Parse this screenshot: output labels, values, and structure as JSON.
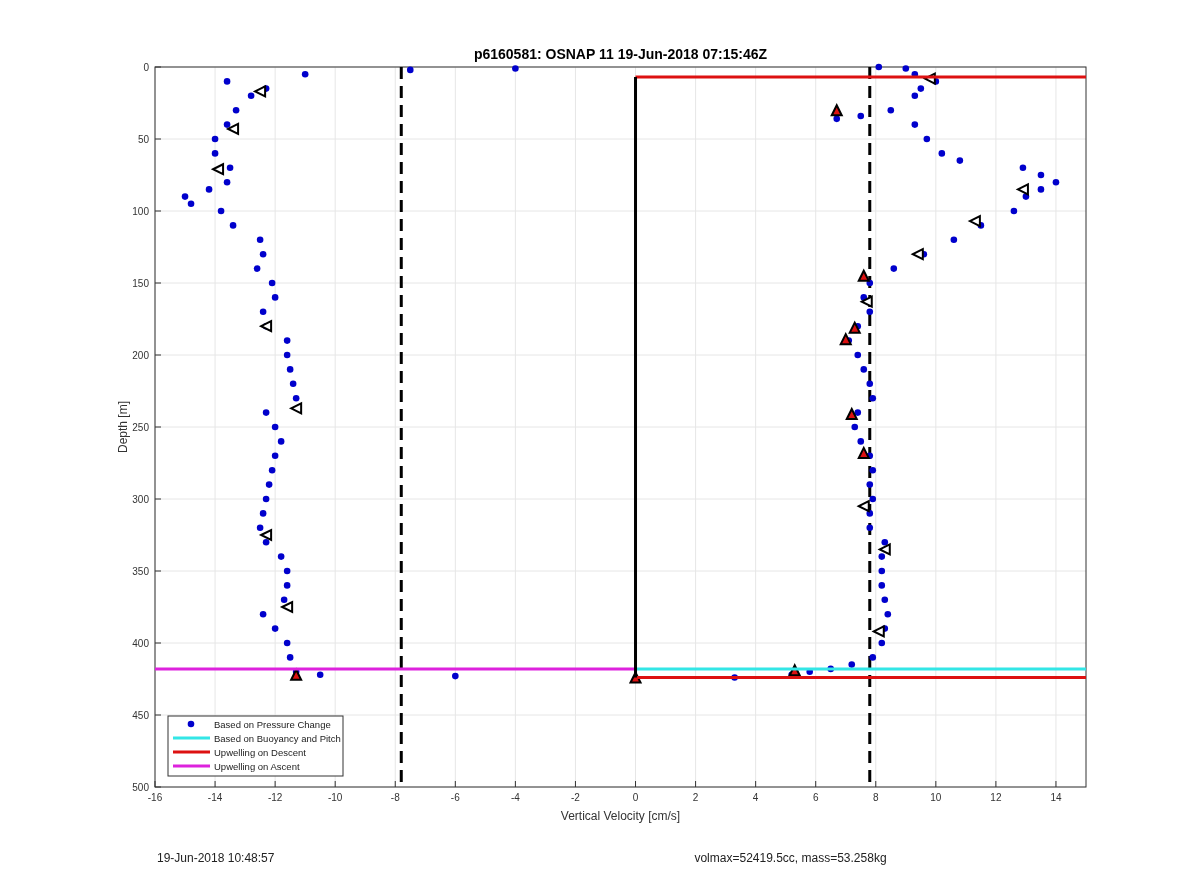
{
  "chart_data": {
    "type": "scatter",
    "title": "p6160581: OSNAP 11 19-Jun-2018 07:15:46Z",
    "xlabel": "Vertical Velocity [cm/s]",
    "ylabel": "Depth [m]",
    "grid": true,
    "legend": true,
    "xlim": [
      -16,
      15
    ],
    "ylim": [
      500,
      0
    ],
    "xticks": [
      -16,
      -14,
      -12,
      -10,
      -8,
      -6,
      -4,
      -2,
      0,
      2,
      4,
      6,
      8,
      10,
      12,
      14
    ],
    "yticks": [
      0,
      50,
      100,
      150,
      200,
      250,
      300,
      350,
      400,
      450,
      500
    ],
    "x": [
      -16,
      0,
      15,
      0,
      -11,
      -13.6,
      -12.3,
      -12.8,
      -13.3,
      -13.6,
      -14,
      -14,
      -13.5,
      -13.6,
      -14.2,
      -15,
      -14.8,
      -13.8,
      -13.4,
      -12.5,
      -12.4,
      -12.6,
      -12.1,
      -12,
      -12.4,
      -12.3,
      -11.6,
      -11.6,
      -11.5,
      -11.4,
      -11.3,
      -12.3,
      -12,
      -11.8,
      -12,
      -12.1,
      -12.2,
      -12.3,
      -12.4,
      -12.5,
      -12.3,
      -11.8,
      -11.6,
      -11.6,
      -11.7,
      -12.4,
      -12,
      -11.6,
      -11.5,
      -11.3,
      -10.5,
      -7.5,
      -4,
      -6,
      8.1,
      9,
      9.3,
      10,
      9.5,
      9.3,
      8.5,
      6.7,
      7.5,
      9.3,
      9.7,
      10.2,
      10.8,
      12.9,
      13.5,
      14,
      13.5,
      13,
      12.6,
      11.5,
      10.6,
      9.6,
      8.6,
      7.8,
      7.6,
      7.8,
      7.4,
      7.1,
      7.4,
      7.6,
      7.8,
      7.9,
      7.4,
      7.3,
      7.5,
      7.8,
      7.9,
      7.8,
      7.9,
      7.8,
      7.8,
      8.3,
      8.2,
      8.2,
      8.2,
      8.3,
      8.4,
      8.3,
      8.2,
      7.9,
      7.2,
      6.5,
      5.8,
      5.2,
      3.3,
      -12.5,
      -13.4,
      -13.9,
      -12.3,
      -11.3,
      -12.3,
      -11.6,
      9.8,
      12.9,
      11.3,
      9.4,
      7.7,
      7.6,
      8.3,
      8.1,
      -11.3,
      6.7,
      7.6,
      7.3,
      7,
      7.2,
      7.6,
      5.3,
      0
    ],
    "series": [
      {
        "name": "Based on Pressure Change",
        "type": "scatter",
        "color": "#0000cc",
        "values": [
          null,
          null,
          null,
          null,
          5,
          10,
          15,
          20,
          30,
          40,
          50,
          60,
          70,
          80,
          85,
          90,
          95,
          100,
          110,
          120,
          130,
          140,
          150,
          160,
          170,
          180,
          190,
          200,
          210,
          220,
          230,
          240,
          250,
          260,
          270,
          280,
          290,
          300,
          310,
          320,
          330,
          340,
          350,
          360,
          370,
          380,
          390,
          400,
          410,
          420,
          422,
          2,
          1,
          423,
          0,
          1,
          5,
          10,
          15,
          20,
          30,
          36,
          34,
          40,
          50,
          60,
          65,
          70,
          75,
          80,
          85,
          90,
          100,
          110,
          120,
          130,
          140,
          150,
          160,
          170,
          180,
          190,
          200,
          210,
          220,
          230,
          240,
          250,
          260,
          270,
          280,
          290,
          300,
          310,
          320,
          330,
          340,
          350,
          360,
          370,
          380,
          390,
          400,
          410,
          415,
          418,
          420,
          422,
          424,
          null,
          null,
          null,
          null,
          null,
          null,
          null,
          null,
          null,
          null,
          null,
          null,
          null,
          null,
          null,
          null,
          null,
          null,
          null,
          null,
          null,
          null,
          null,
          null
        ]
      },
      {
        "type": "scatter",
        "values": [
          null,
          null,
          null,
          null,
          null,
          null,
          null,
          null,
          null,
          null,
          null,
          null,
          null,
          null,
          null,
          null,
          null,
          null,
          null,
          null,
          null,
          null,
          null,
          null,
          null,
          null,
          null,
          null,
          null,
          null,
          null,
          null,
          null,
          null,
          null,
          null,
          null,
          null,
          null,
          null,
          null,
          null,
          null,
          null,
          null,
          null,
          null,
          null,
          null,
          null,
          null,
          null,
          null,
          null,
          null,
          null,
          null,
          null,
          null,
          null,
          null,
          null,
          null,
          null,
          null,
          null,
          null,
          null,
          null,
          null,
          null,
          null,
          null,
          null,
          null,
          null,
          null,
          null,
          null,
          null,
          null,
          null,
          null,
          null,
          null,
          null,
          null,
          null,
          null,
          null,
          null,
          null,
          null,
          null,
          null,
          null,
          null,
          null,
          null,
          null,
          null,
          null,
          null,
          null,
          null,
          null,
          null,
          null,
          null,
          17,
          43,
          71,
          180,
          237,
          325,
          375,
          8,
          85,
          107,
          130,
          163,
          305,
          335,
          392,
          null,
          null,
          null,
          null,
          null,
          null,
          null,
          null,
          null
        ]
      },
      {
        "type": "scatter",
        "color": "#dd1111",
        "values": [
          null,
          null,
          null,
          null,
          null,
          null,
          null,
          null,
          null,
          null,
          null,
          null,
          null,
          null,
          null,
          null,
          null,
          null,
          null,
          null,
          null,
          null,
          null,
          null,
          null,
          null,
          null,
          null,
          null,
          null,
          null,
          null,
          null,
          null,
          null,
          null,
          null,
          null,
          null,
          null,
          null,
          null,
          null,
          null,
          null,
          null,
          null,
          null,
          null,
          null,
          null,
          null,
          null,
          null,
          null,
          null,
          null,
          null,
          null,
          null,
          null,
          null,
          null,
          null,
          null,
          null,
          null,
          null,
          null,
          null,
          null,
          null,
          null,
          null,
          null,
          null,
          null,
          null,
          null,
          null,
          null,
          null,
          null,
          null,
          null,
          null,
          null,
          null,
          null,
          null,
          null,
          null,
          null,
          null,
          null,
          null,
          null,
          null,
          null,
          null,
          null,
          null,
          null,
          null,
          null,
          null,
          null,
          null,
          null,
          null,
          null,
          null,
          null,
          null,
          null,
          null,
          null,
          null,
          null,
          null,
          null,
          null,
          null,
          null,
          422,
          30,
          145,
          181,
          189,
          241,
          268,
          419,
          424
        ]
      },
      {
        "name": "Based on Buoyancy and Pitch",
        "type": "line",
        "color": "#33e6e6",
        "values": [
          null,
          418,
          418,
          null,
          null,
          null,
          null,
          null,
          null,
          null,
          null,
          null,
          null,
          null,
          null,
          null,
          null,
          null,
          null,
          null,
          null,
          null,
          null,
          null,
          null,
          null,
          null,
          null,
          null,
          null,
          null,
          null,
          null,
          null,
          null,
          null,
          null,
          null,
          null,
          null,
          null,
          null,
          null,
          null,
          null,
          null,
          null,
          null,
          null,
          null,
          null,
          null,
          null,
          null,
          null,
          null,
          null,
          null,
          null,
          null,
          null,
          null,
          null,
          null,
          null,
          null,
          null,
          null,
          null,
          null,
          null,
          null,
          null,
          null,
          null,
          null,
          null,
          null,
          null,
          null,
          null,
          null,
          null,
          null,
          null,
          null,
          null,
          null,
          null,
          null,
          null,
          null,
          null,
          null,
          null,
          null,
          null,
          null,
          null,
          null,
          null,
          null,
          null,
          null,
          null,
          null,
          null,
          null,
          null,
          null,
          null,
          null,
          null,
          null,
          null,
          null,
          null,
          null,
          null,
          null,
          null,
          null,
          null,
          null,
          null,
          null,
          null,
          null,
          null,
          null,
          null,
          null,
          null
        ]
      },
      {
        "name": "Upwelling on Descent",
        "type": "line",
        "color": "#dd1111",
        "values": [
          null,
          7,
          7,
          null,
          null,
          null,
          null,
          null,
          null,
          null,
          null,
          null,
          null,
          null,
          null,
          null,
          null,
          null,
          null,
          null,
          null,
          null,
          null,
          null,
          null,
          null,
          null,
          null,
          null,
          null,
          null,
          null,
          null,
          null,
          null,
          null,
          null,
          null,
          null,
          null,
          null,
          null,
          null,
          null,
          null,
          null,
          null,
          null,
          null,
          null,
          null,
          null,
          null,
          null,
          null,
          null,
          null,
          null,
          null,
          null,
          null,
          null,
          null,
          null,
          null,
          null,
          null,
          null,
          null,
          null,
          null,
          null,
          null,
          null,
          null,
          null,
          null,
          null,
          null,
          null,
          null,
          null,
          null,
          null,
          null,
          null,
          null,
          null,
          null,
          null,
          null,
          null,
          null,
          null,
          null,
          null,
          null,
          null,
          null,
          null,
          null,
          null,
          null,
          null,
          null,
          null,
          null,
          null,
          null,
          null,
          null,
          null,
          null,
          null,
          null,
          null,
          null,
          null,
          null,
          null,
          null,
          null,
          null,
          null,
          null,
          null,
          null,
          null,
          null,
          null,
          null,
          null,
          null
        ]
      },
      {
        "type": "line",
        "color": "#dd1111",
        "values": [
          null,
          424,
          424,
          null,
          null,
          null,
          null,
          null,
          null,
          null,
          null,
          null,
          null,
          null,
          null,
          null,
          null,
          null,
          null,
          null,
          null,
          null,
          null,
          null,
          null,
          null,
          null,
          null,
          null,
          null,
          null,
          null,
          null,
          null,
          null,
          null,
          null,
          null,
          null,
          null,
          null,
          null,
          null,
          null,
          null,
          null,
          null,
          null,
          null,
          null,
          null,
          null,
          null,
          null,
          null,
          null,
          null,
          null,
          null,
          null,
          null,
          null,
          null,
          null,
          null,
          null,
          null,
          null,
          null,
          null,
          null,
          null,
          null,
          null,
          null,
          null,
          null,
          null,
          null,
          null,
          null,
          null,
          null,
          null,
          null,
          null,
          null,
          null,
          null,
          null,
          null,
          null,
          null,
          null,
          null,
          null,
          null,
          null,
          null,
          null,
          null,
          null,
          null,
          null,
          null,
          null,
          null,
          null,
          null,
          null,
          null,
          null,
          null,
          null,
          null,
          null,
          null,
          null,
          null,
          null,
          null,
          null,
          null,
          null,
          null,
          null,
          null,
          null,
          null,
          null,
          null,
          null,
          null
        ]
      },
      {
        "name": "Upwelling on Ascent",
        "type": "line",
        "color": "#dd22dd",
        "values": [
          418,
          418,
          null,
          null,
          null,
          null,
          null,
          null,
          null,
          null,
          null,
          null,
          null,
          null,
          null,
          null,
          null,
          null,
          null,
          null,
          null,
          null,
          null,
          null,
          null,
          null,
          null,
          null,
          null,
          null,
          null,
          null,
          null,
          null,
          null,
          null,
          null,
          null,
          null,
          null,
          null,
          null,
          null,
          null,
          null,
          null,
          null,
          null,
          null,
          null,
          null,
          null,
          null,
          null,
          null,
          null,
          null,
          null,
          null,
          null,
          null,
          null,
          null,
          null,
          null,
          null,
          null,
          null,
          null,
          null,
          null,
          null,
          null,
          null,
          null,
          null,
          null,
          null,
          null,
          null,
          null,
          null,
          null,
          null,
          null,
          null,
          null,
          null,
          null,
          null,
          null,
          null,
          null,
          null,
          null,
          null,
          null,
          null,
          null,
          null,
          null,
          null,
          null,
          null,
          null,
          null,
          null,
          null,
          null,
          null,
          null,
          null,
          null,
          null,
          null,
          null,
          null,
          null,
          null,
          null,
          null,
          null,
          null,
          null,
          null,
          null,
          null,
          null,
          null,
          null,
          null,
          null,
          null
        ]
      },
      {
        "type": "line",
        "color": "#000000",
        "values": [
          null,
          7,
          null,
          424,
          null,
          null,
          null,
          null,
          null,
          null,
          null,
          null,
          null,
          null,
          null,
          null,
          null,
          null,
          null,
          null,
          null,
          null,
          null,
          null,
          null,
          null,
          null,
          null,
          null,
          null,
          null,
          null,
          null,
          null,
          null,
          null,
          null,
          null,
          null,
          null,
          null,
          null,
          null,
          null,
          null,
          null,
          null,
          null,
          null,
          null,
          null,
          null,
          null,
          null,
          null,
          null,
          null,
          null,
          null,
          null,
          null,
          null,
          null,
          null,
          null,
          null,
          null,
          null,
          null,
          null,
          null,
          null,
          null,
          null,
          null,
          null,
          null,
          null,
          null,
          null,
          null,
          null,
          null,
          null,
          null,
          null,
          null,
          null,
          null,
          null,
          null,
          null,
          null,
          null,
          null,
          null,
          null,
          null,
          null,
          null,
          null,
          null,
          null,
          null,
          null,
          null,
          null,
          null,
          null,
          null,
          null,
          null,
          null,
          null,
          null,
          null,
          null,
          null,
          null,
          null,
          null,
          null,
          null,
          null,
          null,
          null,
          null,
          null,
          null,
          null,
          null,
          null,
          null
        ]
      }
    ],
    "ref_lines": [
      {
        "axis": "x",
        "value": -7.8,
        "color": "#000000"
      },
      {
        "axis": "x",
        "value": 7.8,
        "color": "#000000"
      }
    ]
  },
  "footer": {
    "timestamp": "19-Jun-2018 10:48:57",
    "info": "volmax=52419.5cc, mass=53.258kg"
  }
}
